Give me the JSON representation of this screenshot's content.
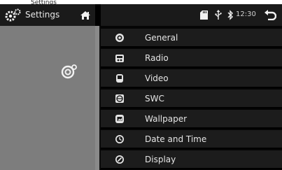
{
  "cutoff_text": "Settings",
  "header": {
    "title": "Settings",
    "clock": "12:30"
  },
  "menu": {
    "items": [
      {
        "label": "General",
        "icon": "general-icon"
      },
      {
        "label": "Radio",
        "icon": "radio-icon"
      },
      {
        "label": "Video",
        "icon": "video-icon"
      },
      {
        "label": "SWC",
        "icon": "swc-icon"
      },
      {
        "label": "Wallpaper",
        "icon": "wallpaper-icon"
      },
      {
        "label": "Date and Time",
        "icon": "clock-icon"
      },
      {
        "label": "Display",
        "icon": "display-icon"
      }
    ]
  },
  "colors": {
    "background": "#0b0b0b",
    "row": "#1c1c1c",
    "sidepanel": "#7d7d7d",
    "text": "#e5e5e5"
  }
}
